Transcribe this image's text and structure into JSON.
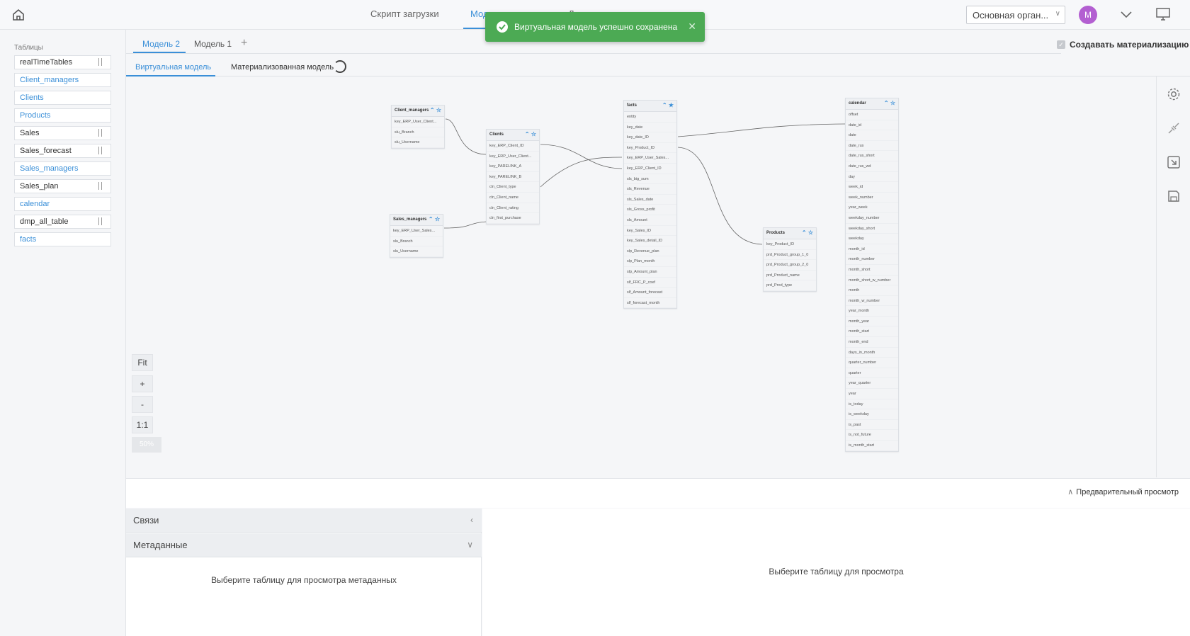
{
  "header": {
    "tabs": [
      {
        "label": "Скрипт загрузки",
        "active": false
      },
      {
        "label": "Мод",
        "active": true
      },
      {
        "label": "Д",
        "active": false
      }
    ],
    "org_select": "Основная орган...",
    "avatar_letter": "M"
  },
  "toast": {
    "message": "Виртуальная модель успешно сохранена",
    "color": "#4caa54"
  },
  "sidebar": {
    "title": "Таблицы",
    "items": [
      {
        "label": "realTimeTables",
        "link": false,
        "draggable": true
      },
      {
        "label": "Client_managers",
        "link": true,
        "draggable": false
      },
      {
        "label": "Clients",
        "link": true,
        "draggable": false
      },
      {
        "label": "Products",
        "link": true,
        "draggable": false
      },
      {
        "label": "Sales",
        "link": false,
        "draggable": true
      },
      {
        "label": "Sales_forecast",
        "link": false,
        "draggable": true
      },
      {
        "label": "Sales_managers",
        "link": true,
        "draggable": false
      },
      {
        "label": "Sales_plan",
        "link": false,
        "draggable": true
      },
      {
        "label": "calendar",
        "link": true,
        "draggable": false
      },
      {
        "label": "dmp_all_table",
        "link": false,
        "draggable": true
      },
      {
        "label": "facts",
        "link": true,
        "draggable": false
      }
    ]
  },
  "model_tabs": {
    "tabs": [
      "Модель 2",
      "Модель 1"
    ],
    "add_label": "+",
    "materialize_label": "Создавать материализацию",
    "materialize_checked": true
  },
  "sub_tabs": {
    "virtual": "Виртуальная модель",
    "materialized": "Материализованная модель"
  },
  "diagram": {
    "tables": [
      {
        "name": "Client_managers",
        "fields": [
          "key_ERP_User_Client...",
          "slu_Branch",
          "slu_Username"
        ]
      },
      {
        "name": "Clients",
        "fields": [
          "key_ERP_Client_ID",
          "key_ERP_User_Client...",
          "key_PARELINK_A",
          "key_PARELINK_B",
          "cln_Client_type",
          "cln_Client_name",
          "cln_Client_rating",
          "cln_first_purchase"
        ]
      },
      {
        "name": "Sales_managers",
        "fields": [
          "key_ERP_User_Sales...",
          "slu_Branch",
          "slu_Username"
        ]
      },
      {
        "name": "facts",
        "fields": [
          "entity",
          "key_date",
          "key_date_ID",
          "key_Product_ID",
          "key_ERP_User_Sales...",
          "key_ERP_Client_ID",
          "sls_big_sum",
          "sls_Revenue",
          "sls_Sales_date",
          "sls_Gross_profit",
          "sls_Amount",
          "key_Sales_ID",
          "key_Sales_detail_ID",
          "slp_Revenue_plan",
          "slp_Plan_month",
          "slp_Amount_plan",
          "slf_FRC_P_coef",
          "slf_Amount_forecast",
          "slf_forecast_month"
        ]
      },
      {
        "name": "Products",
        "fields": [
          "key_Product_ID",
          "prd_Product_group_1_0",
          "prd_Product_group_2_0",
          "prd_Product_name",
          "prd_Prod_type"
        ]
      },
      {
        "name": "calendar",
        "fields": [
          "offset",
          "date_id",
          "date",
          "date_rus",
          "date_rus_short",
          "date_rus_wd",
          "day",
          "week_id",
          "week_number",
          "year_week",
          "weekday_number",
          "weekday_short",
          "weekday",
          "month_id",
          "month_number",
          "month_short",
          "month_short_w_number",
          "month",
          "month_w_number",
          "year_month",
          "month_year",
          "month_start",
          "month_end",
          "days_in_month",
          "quarter_number",
          "quarter",
          "year_quarter",
          "year",
          "is_today",
          "is_weekday",
          "is_past",
          "is_not_future",
          "is_month_start"
        ]
      }
    ]
  },
  "zoom": {
    "fit": "Fit",
    "plus": "+",
    "minus": "-",
    "one_to_one": "1:1",
    "percent": "50%"
  },
  "bottom": {
    "preview_label": "Предварительный просмотр",
    "links_title": "Связи",
    "metadata_title": "Метаданные",
    "metadata_empty": "Выберите таблицу для просмотра метаданных",
    "preview_empty": "Выберите таблицу для просмотра"
  }
}
